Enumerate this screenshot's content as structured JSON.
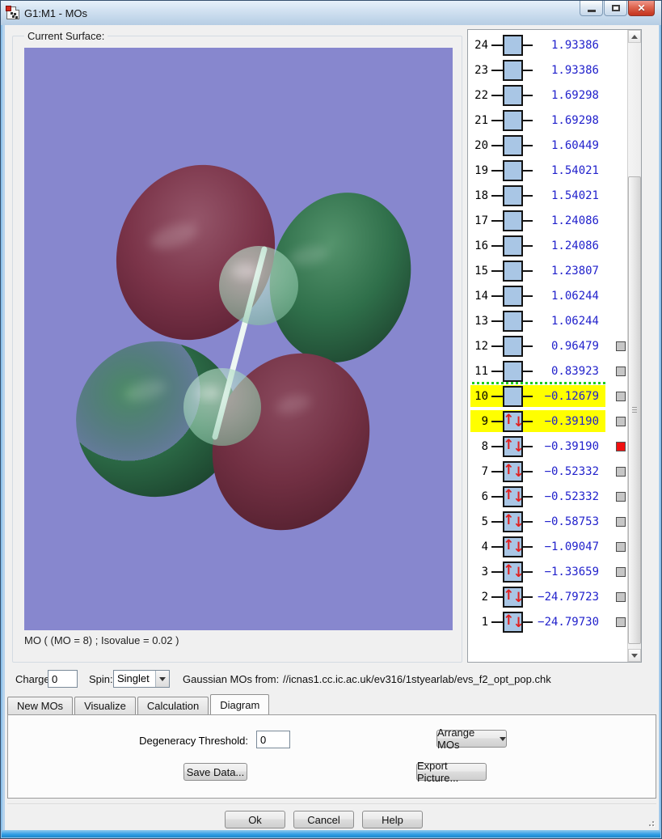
{
  "window": {
    "title": "G1:M1 - MOs"
  },
  "icons": {
    "close": "✕",
    "up_arrow": "↑",
    "down_arrow": "↓"
  },
  "colors": {
    "viewport_bg": "#8787ce",
    "lobe_green": "#2f6f4a",
    "lobe_maroon": "#7b3449",
    "row_highlight": "#ffff00",
    "energy_text": "#2222cc",
    "selected_checkbox": "#f01010",
    "homo_divider": "#1ecc1e",
    "orbital_box_fill": "#a9c6e5"
  },
  "surface": {
    "group_label": "Current Surface:",
    "caption": "MO ( (MO = 8) ; Isovalue = 0.02 )"
  },
  "mo_list": {
    "divider_above_num": "10",
    "rows": [
      {
        "num": "24",
        "energy": "1.93386",
        "occupied": false,
        "checkbox": "none",
        "highlight": false
      },
      {
        "num": "23",
        "energy": "1.93386",
        "occupied": false,
        "checkbox": "none",
        "highlight": false
      },
      {
        "num": "22",
        "energy": "1.69298",
        "occupied": false,
        "checkbox": "none",
        "highlight": false
      },
      {
        "num": "21",
        "energy": "1.69298",
        "occupied": false,
        "checkbox": "none",
        "highlight": false
      },
      {
        "num": "20",
        "energy": "1.60449",
        "occupied": false,
        "checkbox": "none",
        "highlight": false
      },
      {
        "num": "19",
        "energy": "1.54021",
        "occupied": false,
        "checkbox": "none",
        "highlight": false
      },
      {
        "num": "18",
        "energy": "1.54021",
        "occupied": false,
        "checkbox": "none",
        "highlight": false
      },
      {
        "num": "17",
        "energy": "1.24086",
        "occupied": false,
        "checkbox": "none",
        "highlight": false
      },
      {
        "num": "16",
        "energy": "1.24086",
        "occupied": false,
        "checkbox": "none",
        "highlight": false
      },
      {
        "num": "15",
        "energy": "1.23807",
        "occupied": false,
        "checkbox": "none",
        "highlight": false
      },
      {
        "num": "14",
        "energy": "1.06244",
        "occupied": false,
        "checkbox": "none",
        "highlight": false
      },
      {
        "num": "13",
        "energy": "1.06244",
        "occupied": false,
        "checkbox": "none",
        "highlight": false
      },
      {
        "num": "12",
        "energy": "0.96479",
        "occupied": false,
        "checkbox": "gray",
        "highlight": false
      },
      {
        "num": "11",
        "energy": "0.83923",
        "occupied": false,
        "checkbox": "gray",
        "highlight": false
      },
      {
        "num": "10",
        "energy": "−0.12679",
        "occupied": false,
        "checkbox": "gray",
        "highlight": true
      },
      {
        "num": "9",
        "energy": "−0.39190",
        "occupied": true,
        "checkbox": "gray",
        "highlight": true
      },
      {
        "num": "8",
        "energy": "−0.39190",
        "occupied": true,
        "checkbox": "red",
        "highlight": false
      },
      {
        "num": "7",
        "energy": "−0.52332",
        "occupied": true,
        "checkbox": "gray",
        "highlight": false
      },
      {
        "num": "6",
        "energy": "−0.52332",
        "occupied": true,
        "checkbox": "gray",
        "highlight": false
      },
      {
        "num": "5",
        "energy": "−0.58753",
        "occupied": true,
        "checkbox": "gray",
        "highlight": false
      },
      {
        "num": "4",
        "energy": "−1.09047",
        "occupied": true,
        "checkbox": "gray",
        "highlight": false
      },
      {
        "num": "3",
        "energy": "−1.33659",
        "occupied": true,
        "checkbox": "gray",
        "highlight": false
      },
      {
        "num": "2",
        "energy": "−24.79723",
        "occupied": true,
        "checkbox": "gray",
        "highlight": false
      },
      {
        "num": "1",
        "energy": "−24.79730",
        "occupied": true,
        "checkbox": "gray",
        "highlight": false
      }
    ]
  },
  "controls_row": {
    "charge_label": "Charge:",
    "charge_value": "0",
    "spin_label": "Spin:",
    "spin_value": "Singlet",
    "source_label": "Gaussian MOs from:",
    "source_path": "//icnas1.cc.ic.ac.uk/ev316/1styearlab/evs_f2_opt_pop.chk"
  },
  "tabs": [
    {
      "label": "New MOs",
      "active": false
    },
    {
      "label": "Visualize",
      "active": false
    },
    {
      "label": "Calculation",
      "active": false
    },
    {
      "label": "Diagram",
      "active": true
    }
  ],
  "diagram_tab": {
    "degeneracy_label": "Degeneracy Threshold:",
    "degeneracy_value": "0",
    "arrange_label": "Arrange MOs",
    "save_label": "Save Data...",
    "export_label": "Export Picture..."
  },
  "footer": {
    "ok_label": "Ok",
    "cancel_label": "Cancel",
    "help_label": "Help"
  }
}
